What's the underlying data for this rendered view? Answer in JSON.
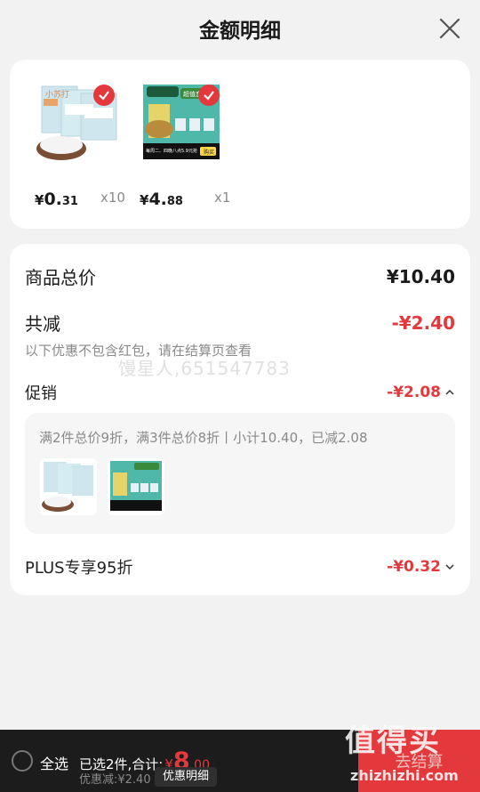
{
  "header": {
    "title": "金额明细"
  },
  "products": [
    {
      "yen": "¥",
      "int": "0.",
      "dec": "31",
      "qty": "x10",
      "name_on_pack": "小苏打"
    },
    {
      "yen": "¥",
      "int": "4.",
      "dec": "88",
      "qty": "x1",
      "banner": "超值恋爱日",
      "footer": "每周二、四晚八点5.9元抢",
      "cta": "购买"
    }
  ],
  "summary": {
    "total_label": "商品总价",
    "total_value": "¥10.40",
    "reduce_label": "共减",
    "reduce_value": "-¥2.40",
    "note": "以下优惠不包含红包，请在结算页查看",
    "watermark": "馒星人,651547783"
  },
  "promo": {
    "label": "促销",
    "value": "-¥2.08",
    "desc": "满2件总价9折，满3件总价8折丨小计10.40，已减2.08"
  },
  "plus": {
    "label": "PLUS专享95折",
    "value": "-¥0.32"
  },
  "bottom": {
    "select_all": "全选",
    "chosen_text": "已选2件,合计:",
    "total_yen": "¥",
    "total_int": "8",
    "total_dec": ".00",
    "saved": "优惠减:¥2.40",
    "detail_button": "优惠明细",
    "checkout": "去结算"
  },
  "brand_watermark": {
    "main": "值得买",
    "sub": "zhizhizhi.com"
  },
  "colors": {
    "accent": "#e4393c",
    "bottom_bar": "#1c1c1c",
    "background": "#f2f2f2"
  }
}
